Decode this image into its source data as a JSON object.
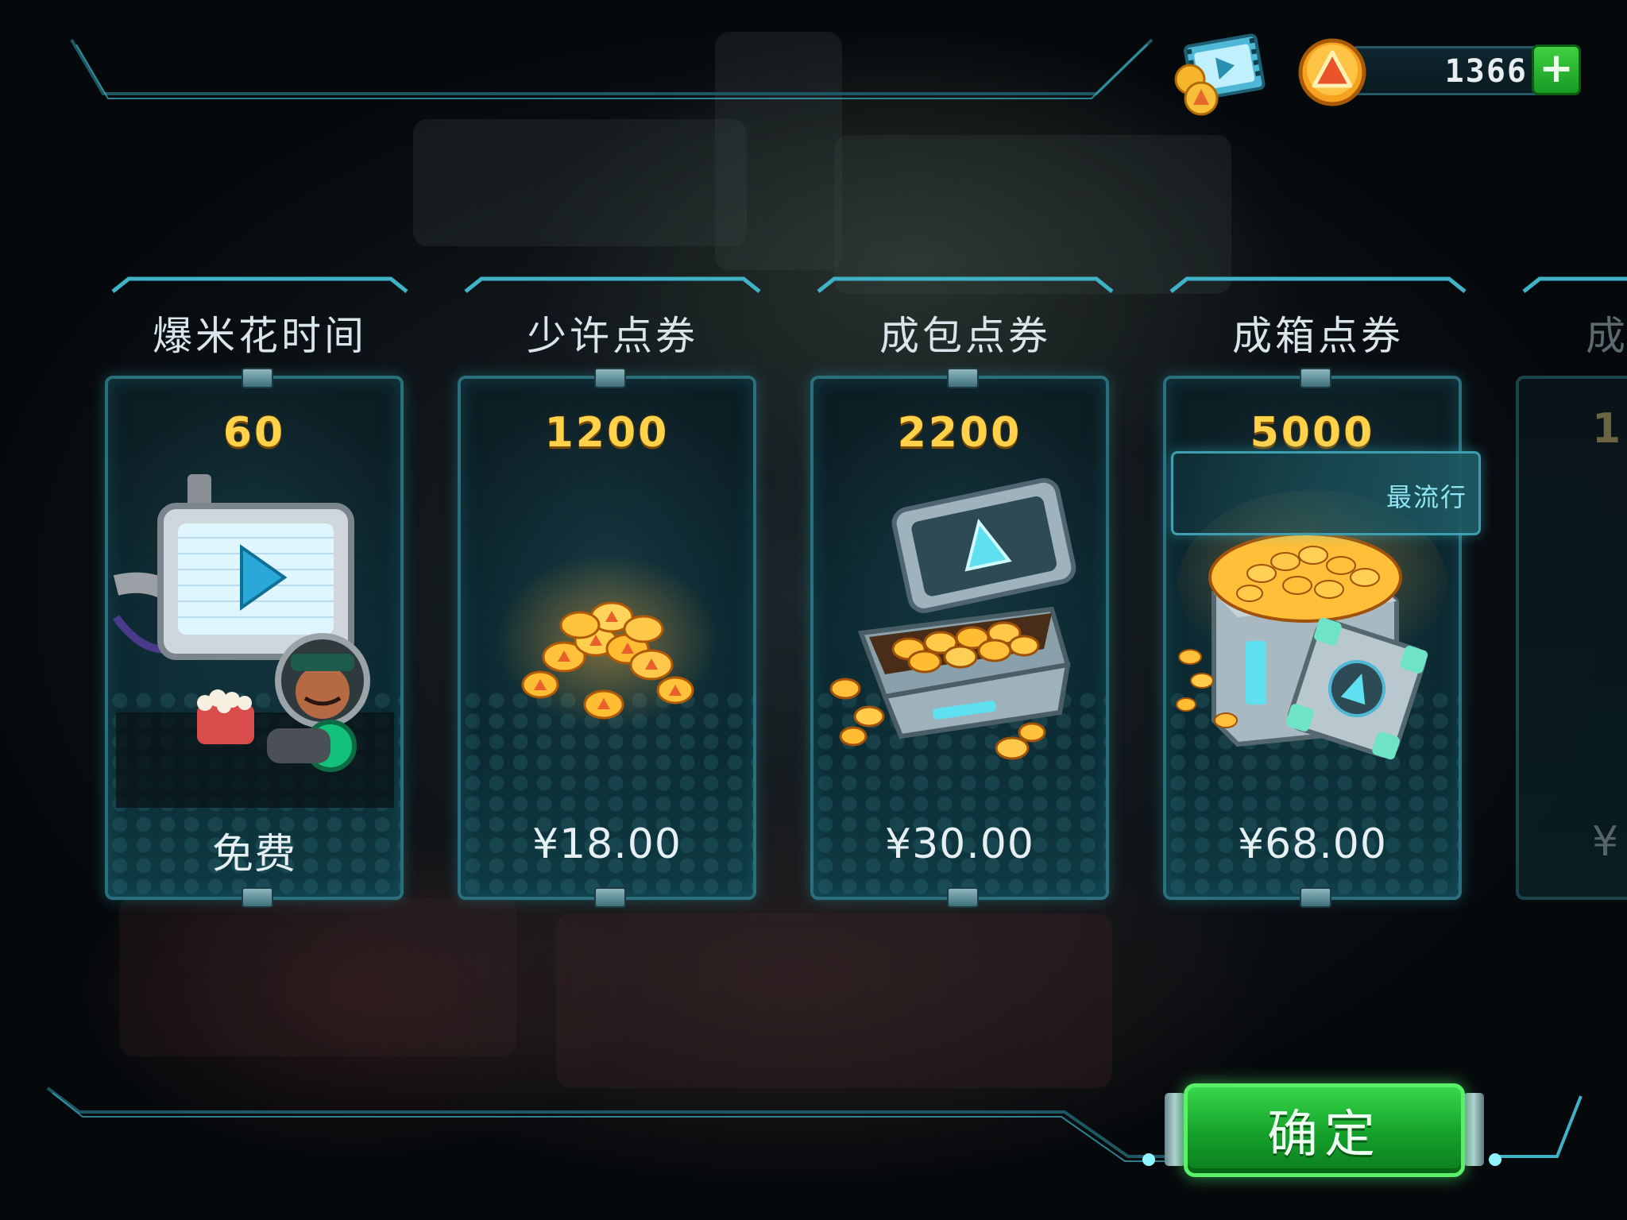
{
  "header": {
    "currency_amount": "1366",
    "add_label": "+"
  },
  "offers": [
    {
      "title": "爆米花时间",
      "amount": "60",
      "price": "免费",
      "art": "video-icon"
    },
    {
      "title": "少许点券",
      "amount": "1200",
      "price": "¥18.00",
      "art": "coin-pile-icon"
    },
    {
      "title": "成包点券",
      "amount": "2200",
      "price": "¥30.00",
      "art": "coin-chest-icon"
    },
    {
      "title": "成箱点券",
      "amount": "5000",
      "price": "¥68.00",
      "art": "coin-crate-icon",
      "badge": "最流行"
    },
    {
      "title": "成",
      "amount": "1",
      "price": "¥"
    }
  ],
  "footer": {
    "confirm_label": "确定"
  },
  "colors": {
    "accent": "#2b6f7d",
    "amount": "#ffd24a",
    "confirm": "#14a02a"
  }
}
